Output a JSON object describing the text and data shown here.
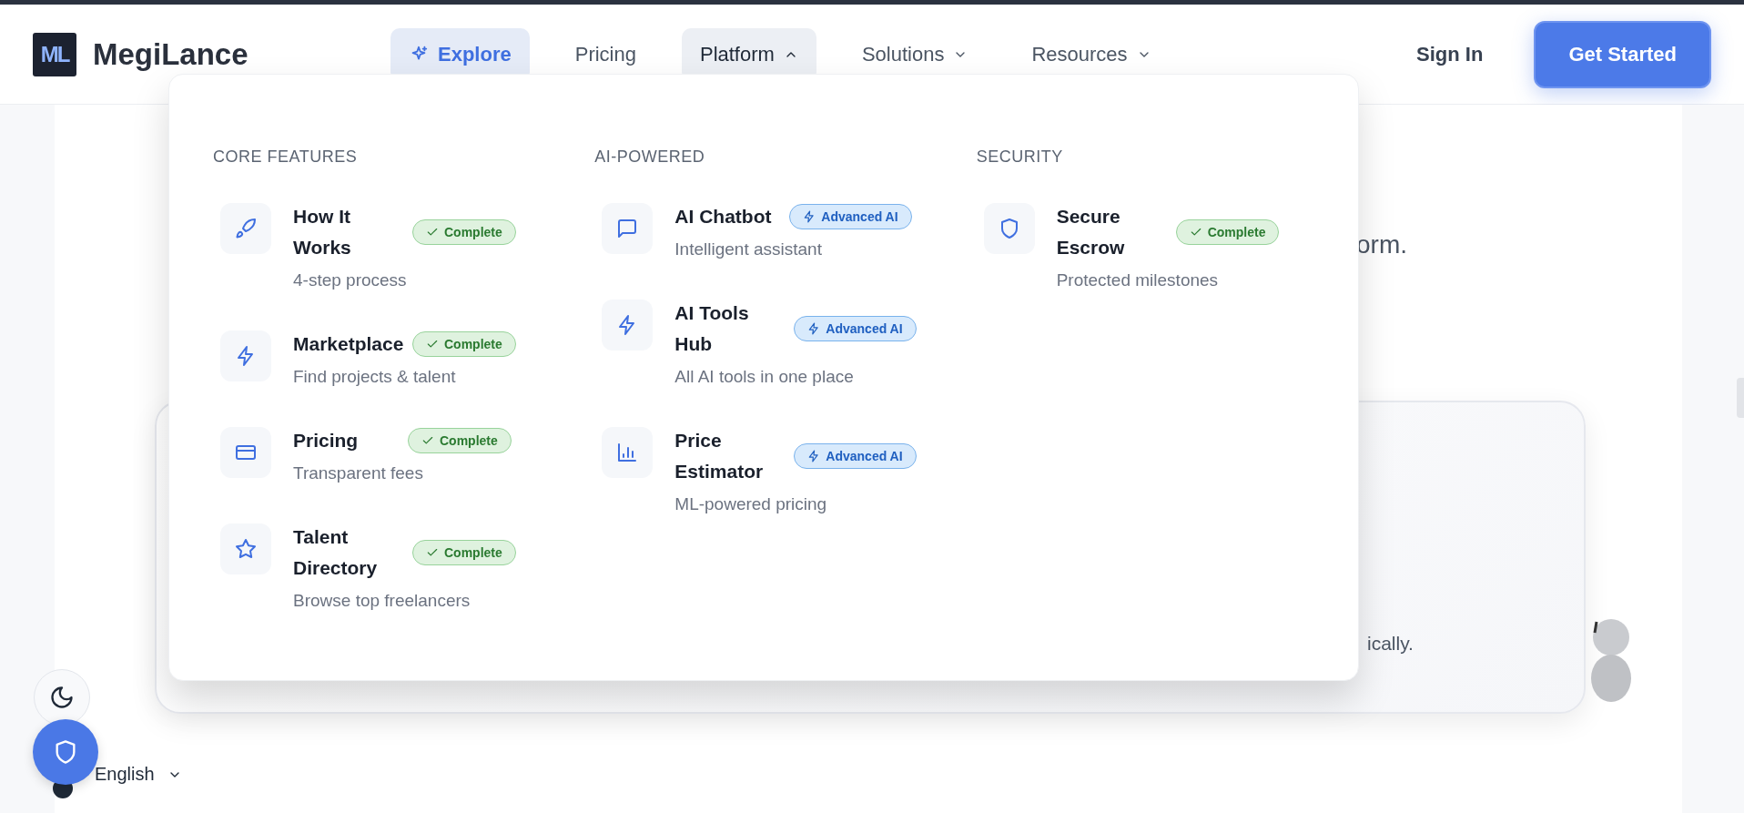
{
  "brand": {
    "logo": "ML",
    "name": "MegiLance"
  },
  "nav": [
    {
      "label": "Explore",
      "kind": "featured"
    },
    {
      "label": "Pricing",
      "kind": "link"
    },
    {
      "label": "Platform",
      "kind": "dropdown",
      "expanded": true
    },
    {
      "label": "Solutions",
      "kind": "dropdown",
      "expanded": false
    },
    {
      "label": "Resources",
      "kind": "dropdown",
      "expanded": false
    }
  ],
  "auth": {
    "sign_in": "Sign In",
    "cta": "Get Started"
  },
  "menu": {
    "sections": [
      {
        "title": "CORE FEATURES",
        "items": [
          {
            "title": "How It Works",
            "subtitle": "4-step process",
            "badge": {
              "label": "Complete",
              "kind": "complete"
            }
          },
          {
            "title": "Marketplace",
            "subtitle": "Find projects & talent",
            "badge": {
              "label": "Complete",
              "kind": "complete"
            }
          },
          {
            "title": "Pricing",
            "subtitle": "Transparent fees",
            "badge": {
              "label": "Complete",
              "kind": "complete"
            }
          },
          {
            "title": "Talent Directory",
            "subtitle": "Browse top freelancers",
            "badge": {
              "label": "Complete",
              "kind": "complete"
            }
          }
        ]
      },
      {
        "title": "AI-POWERED",
        "items": [
          {
            "title": "AI Chatbot",
            "subtitle": "Intelligent assistant",
            "badge": {
              "label": "Advanced AI",
              "kind": "ai"
            }
          },
          {
            "title": "AI Tools Hub",
            "subtitle": "All AI tools in one place",
            "badge": {
              "label": "Advanced AI",
              "kind": "ai"
            }
          },
          {
            "title": "Price Estimator",
            "subtitle": "ML-powered pricing",
            "badge": {
              "label": "Advanced AI",
              "kind": "ai"
            }
          }
        ]
      },
      {
        "title": "SECURITY",
        "items": [
          {
            "title": "Secure Escrow",
            "subtitle": "Protected milestones",
            "badge": {
              "label": "Complete",
              "kind": "complete"
            }
          }
        ]
      }
    ]
  },
  "background_text": [
    "orm.",
    "ically."
  ],
  "language": "English"
}
